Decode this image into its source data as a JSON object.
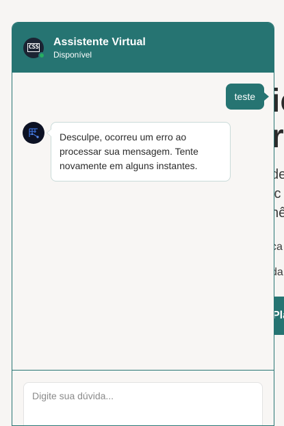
{
  "background_page": {
    "heading_line1": "ic",
    "heading_line2": "ra",
    "para_line1": "de",
    "para_line2": "ic",
    "para_line3": "nê",
    "small_line1": "ca",
    "small_line2": "da",
    "cta_label": "Pla"
  },
  "chat": {
    "title": "Assistente Virtual",
    "status": "Disponível",
    "avatar_logo_text": "CSS",
    "messages": [
      {
        "from": "user",
        "text": "teste"
      },
      {
        "from": "bot",
        "text": "Desculpe, ocorreu um erro ao processar sua mensagem. Tente novamente em alguns instantes."
      }
    ],
    "input": {
      "placeholder": "Digite sua dúvida...",
      "value": ""
    }
  },
  "colors": {
    "primary": "#267472",
    "status_online": "#27ae60",
    "background": "#f7f5f3"
  },
  "icons": {
    "header_avatar": "css-logo-icon",
    "bot_avatar": "bot-avatar-icon"
  }
}
